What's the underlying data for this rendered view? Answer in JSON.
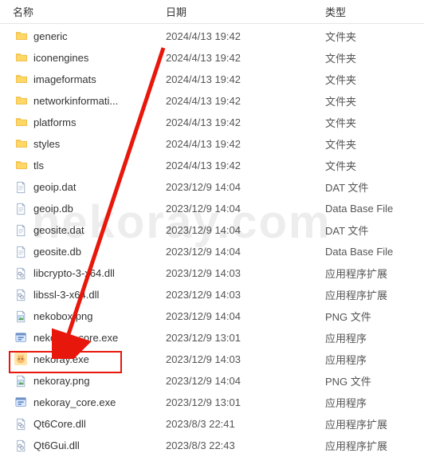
{
  "headers": {
    "name": "名称",
    "date": "日期",
    "type": "类型"
  },
  "watermark": "nekoray.com",
  "rows": [
    {
      "icon": "folder",
      "name": "generic",
      "date": "2024/4/13 19:42",
      "type": "文件夹"
    },
    {
      "icon": "folder",
      "name": "iconengines",
      "date": "2024/4/13 19:42",
      "type": "文件夹"
    },
    {
      "icon": "folder",
      "name": "imageformats",
      "date": "2024/4/13 19:42",
      "type": "文件夹"
    },
    {
      "icon": "folder",
      "name": "networkinformati...",
      "date": "2024/4/13 19:42",
      "type": "文件夹"
    },
    {
      "icon": "folder",
      "name": "platforms",
      "date": "2024/4/13 19:42",
      "type": "文件夹"
    },
    {
      "icon": "folder",
      "name": "styles",
      "date": "2024/4/13 19:42",
      "type": "文件夹"
    },
    {
      "icon": "folder",
      "name": "tls",
      "date": "2024/4/13 19:42",
      "type": "文件夹"
    },
    {
      "icon": "file",
      "name": "geoip.dat",
      "date": "2023/12/9 14:04",
      "type": "DAT 文件"
    },
    {
      "icon": "file",
      "name": "geoip.db",
      "date": "2023/12/9 14:04",
      "type": "Data Base File"
    },
    {
      "icon": "file",
      "name": "geosite.dat",
      "date": "2023/12/9 14:04",
      "type": "DAT 文件"
    },
    {
      "icon": "file",
      "name": "geosite.db",
      "date": "2023/12/9 14:04",
      "type": "Data Base File"
    },
    {
      "icon": "dll",
      "name": "libcrypto-3-x64.dll",
      "date": "2023/12/9 14:03",
      "type": "应用程序扩展"
    },
    {
      "icon": "dll",
      "name": "libssl-3-x64.dll",
      "date": "2023/12/9 14:03",
      "type": "应用程序扩展"
    },
    {
      "icon": "png",
      "name": "nekobox.png",
      "date": "2023/12/9 14:04",
      "type": "PNG 文件"
    },
    {
      "icon": "exe",
      "name": "nekobox_core.exe",
      "date": "2023/12/9 13:01",
      "type": "应用程序"
    },
    {
      "icon": "nekoray",
      "name": "nekoray.exe",
      "date": "2023/12/9 14:03",
      "type": "应用程序",
      "highlight": true
    },
    {
      "icon": "png",
      "name": "nekoray.png",
      "date": "2023/12/9 14:04",
      "type": "PNG 文件"
    },
    {
      "icon": "exe",
      "name": "nekoray_core.exe",
      "date": "2023/12/9 13:01",
      "type": "应用程序"
    },
    {
      "icon": "dll",
      "name": "Qt6Core.dll",
      "date": "2023/8/3 22:41",
      "type": "应用程序扩展"
    },
    {
      "icon": "dll",
      "name": "Qt6Gui.dll",
      "date": "2023/8/3 22:43",
      "type": "应用程序扩展"
    }
  ]
}
